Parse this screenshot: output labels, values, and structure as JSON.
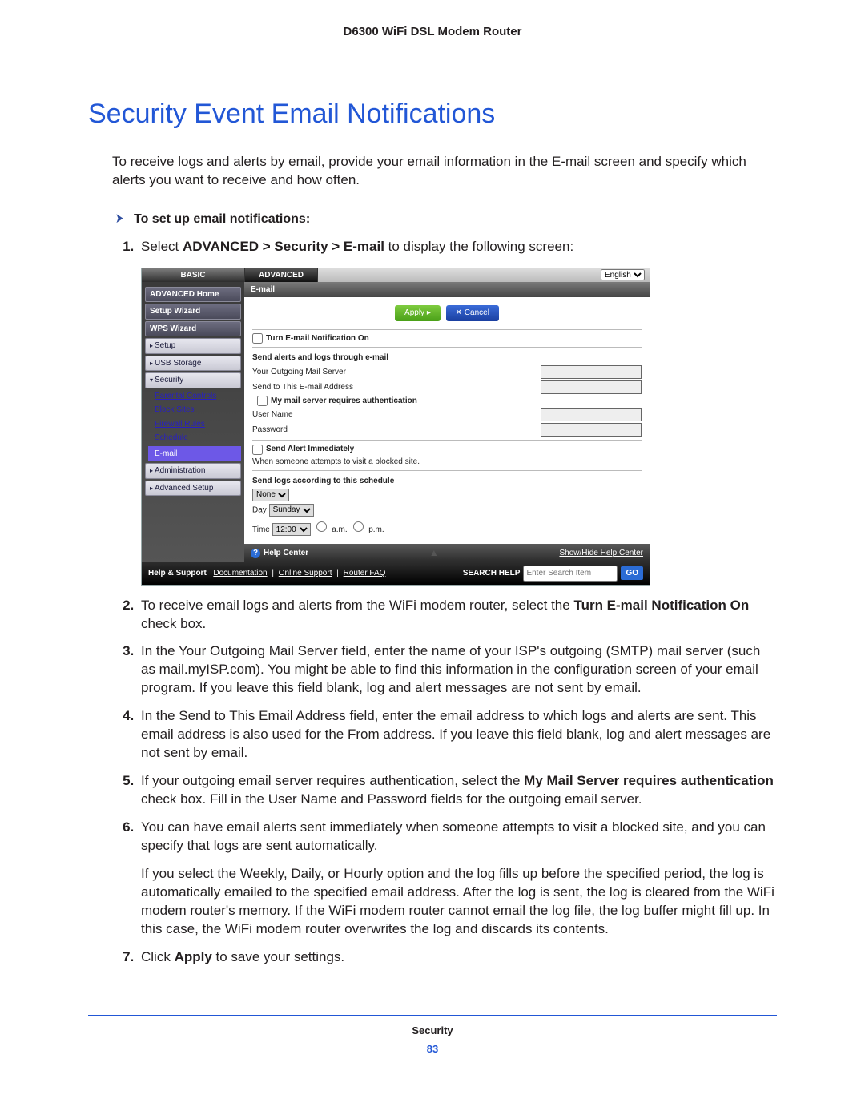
{
  "header": "D6300 WiFi DSL Modem Router",
  "title": "Security Event Email Notifications",
  "intro": "To receive logs and alerts by email, provide your email information in the E-mail screen and specify which alerts you want to receive and how often.",
  "task_heading": "To set up email notifications:",
  "steps": {
    "s1_a": "Select ",
    "s1_b": "ADVANCED > Security > E-mail",
    "s1_c": " to display the following screen:",
    "s2_a": "To receive email logs and alerts from the WiFi modem router, select the ",
    "s2_b": "Turn E-mail Notification On",
    "s2_c": " check box.",
    "s3": "In the Your Outgoing Mail Server field, enter the name of your ISP's outgoing (SMTP) mail server (such as mail.myISP.com). You might be able to find this information in the configuration screen of your email program. If you leave this field blank, log and alert messages are not sent by email.",
    "s4": "In the Send to This Email Address field, enter the email address to which logs and alerts are sent. This email address is also used for the From address. If you leave this field blank, log and alert messages are not sent by email.",
    "s5_a": "If your outgoing email server requires authentication, select the ",
    "s5_b": "My Mail Server requires authentication",
    "s5_c": " check box. Fill in the User Name and Password fields for the outgoing email server.",
    "s6": "You can have email alerts sent immediately when someone attempts to visit a blocked site, and you can specify that logs are sent automatically.",
    "after6": "If you select the Weekly, Daily, or Hourly option and the log fills up before the specified period, the log is automatically emailed to the specified email address. After the log is sent, the log is cleared from the WiFi modem router's memory. If the WiFi modem router cannot email the log file, the log buffer might fill up. In this case, the WiFi modem router overwrites the log and discards its contents.",
    "s7_a": "Click ",
    "s7_b": "Apply",
    "s7_c": " to save your settings."
  },
  "shot": {
    "tabs": {
      "basic": "BASIC",
      "advanced": "ADVANCED",
      "lang": "English"
    },
    "side": {
      "home": "ADVANCED Home",
      "setupwiz": "Setup Wizard",
      "wps": "WPS Wizard",
      "setup": "Setup",
      "usb": "USB Storage",
      "security": "Security",
      "parental": "Parental Controls",
      "block": "Block Sites",
      "firewall": "Firewall Rules",
      "schedule": "Schedule",
      "email": "E-mail",
      "admin": "Administration",
      "advsetup": "Advanced Setup"
    },
    "main": {
      "title": "E-mail",
      "apply": "Apply ▸",
      "cancel": "✕ Cancel",
      "turn_on": "Turn E-mail Notification On",
      "sect1": "Send alerts and logs through e-mail",
      "outgoing": "Your Outgoing Mail Server",
      "sendto": "Send to This E-mail Address",
      "auth": "My mail server requires authentication",
      "username": "User Name",
      "password": "Password",
      "alert_immediate": "Send Alert Immediately",
      "alert_desc": "When someone attempts to visit a blocked site.",
      "sect2": "Send logs according to this schedule",
      "sched": "None",
      "day_label": "Day",
      "day": "Sunday",
      "time_label": "Time",
      "time": "12:00",
      "am": "a.m.",
      "pm": "p.m."
    },
    "help": {
      "center": "Help Center",
      "toggle": "Show/Hide Help Center"
    },
    "foot": {
      "label": "Help & Support",
      "doc": "Documentation",
      "online": "Online Support",
      "faq": "Router FAQ",
      "search_label": "SEARCH HELP",
      "search_ph": "Enter Search Item",
      "go": "GO"
    }
  },
  "footer": {
    "section": "Security",
    "page": "83"
  }
}
